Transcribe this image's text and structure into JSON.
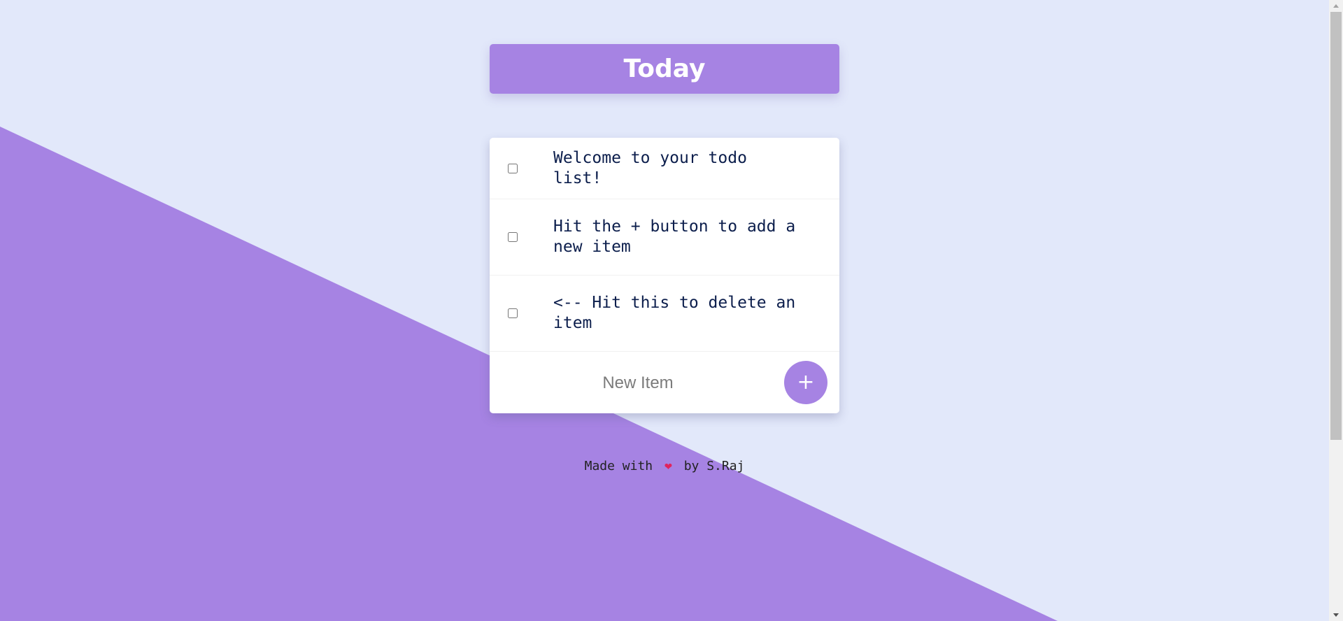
{
  "app": {
    "heading": "Today"
  },
  "todo": {
    "items": [
      {
        "text": "Welcome to your todo list!",
        "checked": false
      },
      {
        "text": "Hit the + button to add a new item",
        "checked": false
      },
      {
        "text": "<-- Hit this to delete an item",
        "checked": false
      }
    ],
    "new_item_placeholder": "New Item",
    "new_item_value": "",
    "add_button_label": "+"
  },
  "footer": {
    "prefix": "Made with",
    "heart_icon": "❤",
    "suffix": "by S.Raj"
  },
  "colors": {
    "background": "#e2e8fa",
    "accent": "#a683e3",
    "card": "#ffffff",
    "text": "#0c1e4c"
  }
}
